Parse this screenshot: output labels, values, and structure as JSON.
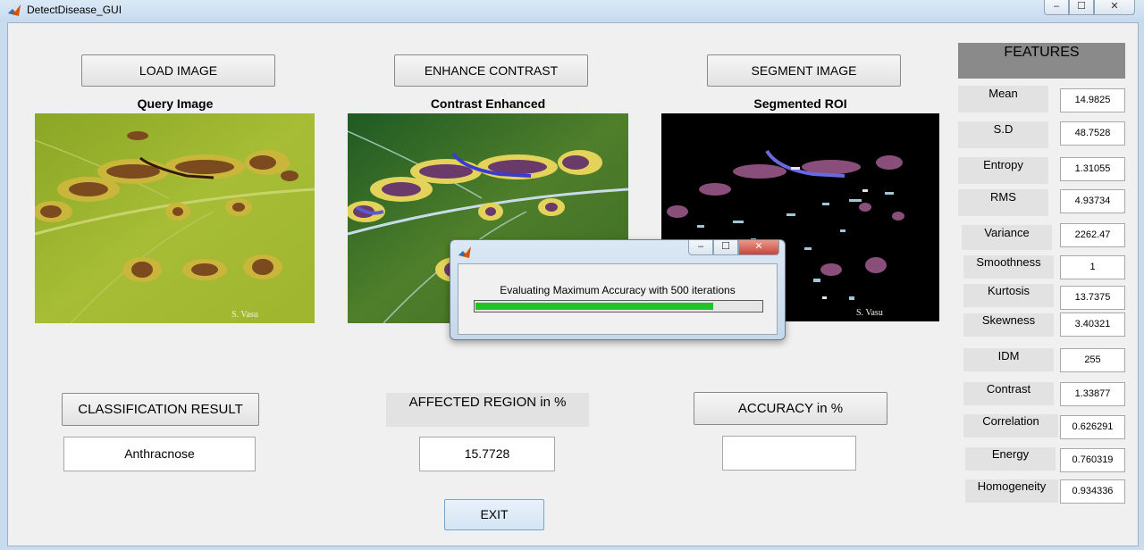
{
  "window": {
    "title": "DetectDisease_GUI",
    "controls": {
      "minimize": "–",
      "maximize": "☐",
      "close": "✕"
    }
  },
  "buttons": {
    "load": "LOAD IMAGE",
    "enhance": "ENHANCE CONTRAST",
    "segment": "SEGMENT IMAGE",
    "classification": "CLASSIFICATION RESULT",
    "accuracy": "ACCURACY in %",
    "exit": "EXIT"
  },
  "panels": [
    {
      "caption": "Query Image",
      "watermark": "S. Vasu"
    },
    {
      "caption": "Contrast Enhanced"
    },
    {
      "caption": "Segmented ROI",
      "watermark": "S. Vasu"
    }
  ],
  "results": {
    "classification_value": "Anthracnose",
    "affected_label": "AFFECTED REGION in %",
    "affected_value": "15.7728",
    "accuracy_value": ""
  },
  "features": {
    "title": "FEATURES",
    "items": [
      {
        "label": "Mean",
        "value": "14.9825"
      },
      {
        "label": "S.D",
        "value": "48.7528"
      },
      {
        "label": "Entropy",
        "value": "1.31055"
      },
      {
        "label": "RMS",
        "value": "4.93734"
      },
      {
        "label": "Variance",
        "value": "2262.47"
      },
      {
        "label": "Smoothness",
        "value": "1"
      },
      {
        "label": "Kurtosis",
        "value": "13.7375"
      },
      {
        "label": "Skewness",
        "value": "3.40321"
      },
      {
        "label": "IDM",
        "value": "255"
      },
      {
        "label": "Contrast",
        "value": "1.33877"
      },
      {
        "label": "Correlation",
        "value": "0.626291"
      },
      {
        "label": "Energy",
        "value": "0.760319"
      },
      {
        "label": "Homogeneity",
        "value": "0.934336"
      }
    ]
  },
  "progress_dialog": {
    "message": "Evaluating Maximum Accuracy with 500 iterations",
    "progress": 0.83,
    "controls": {
      "minimize": "–",
      "maximize": "☐",
      "close": "✕"
    }
  },
  "colors": {
    "progress_fill": "#22c322",
    "panel_background": "#f0f0f0",
    "features_header": "#8a8a8a"
  }
}
